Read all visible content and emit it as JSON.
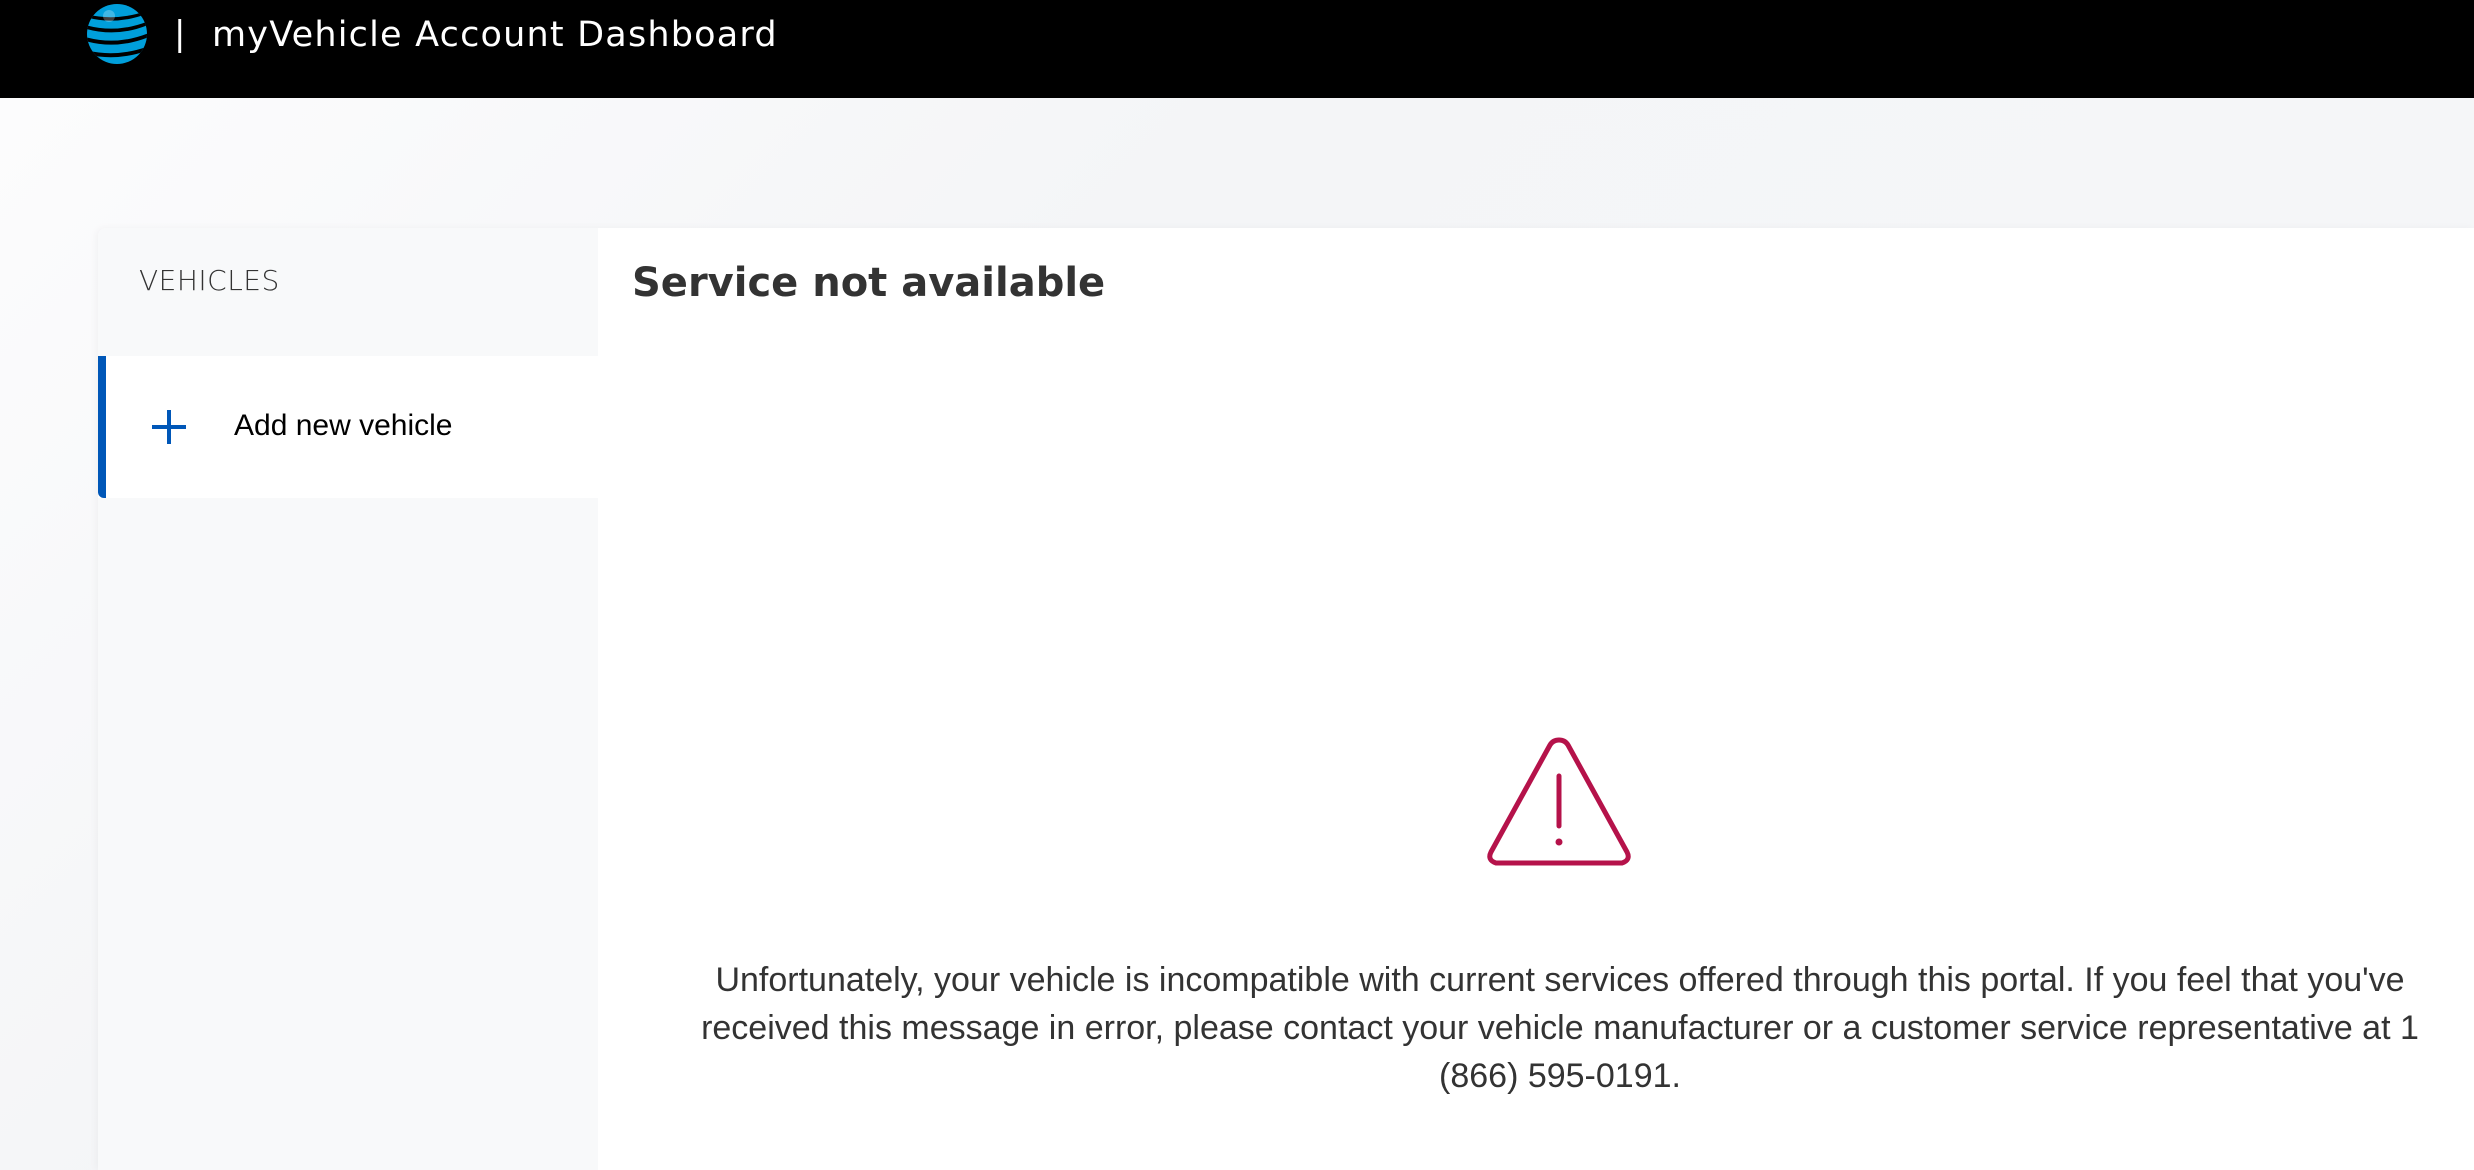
{
  "header": {
    "logo_icon": "att-globe-icon",
    "separator": "|",
    "title": "myVehicle Account Dashboard"
  },
  "sidebar": {
    "heading": "VEHICLES",
    "items": [
      {
        "label": "Add new vehicle",
        "icon": "plus-icon",
        "active": true
      }
    ]
  },
  "main": {
    "title": "Service not available",
    "alert_icon": "warning-triangle-icon",
    "message": "Unfortunately, your vehicle is incompatible with current services offered through this portal. If you feel that you've received this message in error, please contact your vehicle manufacturer or a customer service representative at 1 (866) 595-0191."
  },
  "colors": {
    "topbar": "#000000",
    "accent": "#0057b8",
    "logo_blue": "#009fdb",
    "warning": "#b5124a",
    "text": "#333333"
  }
}
